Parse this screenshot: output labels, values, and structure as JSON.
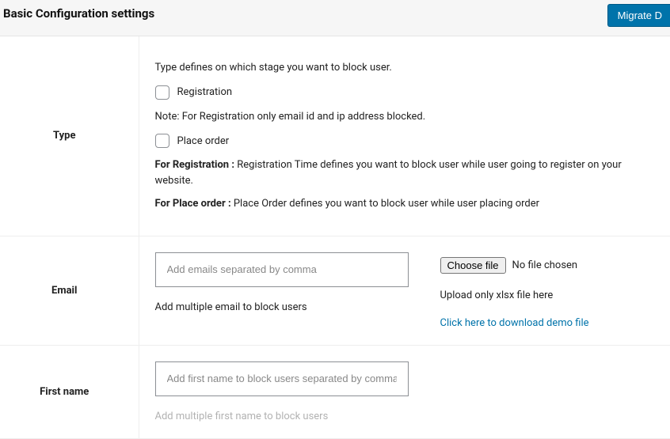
{
  "header": {
    "title": "Basic Configuration settings",
    "migrate_btn": "Migrate D"
  },
  "rows": {
    "type": {
      "label": "Type",
      "intro": "Type defines on which stage you want to block user.",
      "cb1": "Registration",
      "note": "Note: For Registration only email id and ip address blocked.",
      "cb2": "Place order",
      "exp1_label": "For Registration : ",
      "exp1_text": "Registration Time defines you want to block user while user going to register on your website.",
      "exp2_label": "For Place order : ",
      "exp2_text": "Place Order defines you want to block user while user placing order"
    },
    "email": {
      "label": "Email",
      "placeholder": "Add emails separated by comma",
      "helper": "Add multiple email to block users",
      "choose_btn": "Choose file",
      "file_status": "No file chosen",
      "upload_note": "Upload only xlsx file here",
      "download_link": "Click here to download demo file"
    },
    "firstname": {
      "label": "First name",
      "placeholder": "Add first name to block users separated by comma",
      "helper": "Add multiple first name to block users"
    }
  }
}
